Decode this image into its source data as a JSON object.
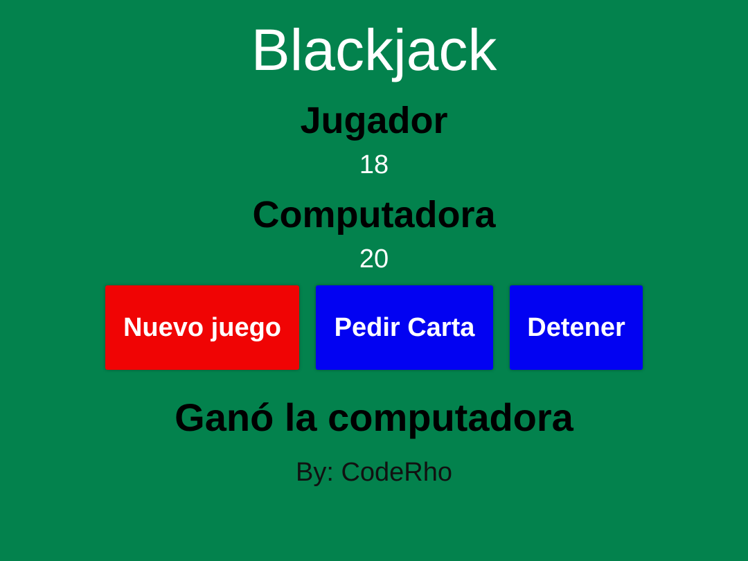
{
  "title": "Blackjack",
  "player": {
    "label": "Jugador",
    "score": "18"
  },
  "computer": {
    "label": "Computadora",
    "score": "20"
  },
  "buttons": {
    "new_game": "Nuevo juego",
    "hit": "Pedir Carta",
    "stop": "Detener"
  },
  "result": "Ganó la computadora",
  "credit": "By: CodeRho",
  "colors": {
    "background": "#03824d",
    "new_game_button": "#f00404",
    "action_button": "#0202f2"
  }
}
